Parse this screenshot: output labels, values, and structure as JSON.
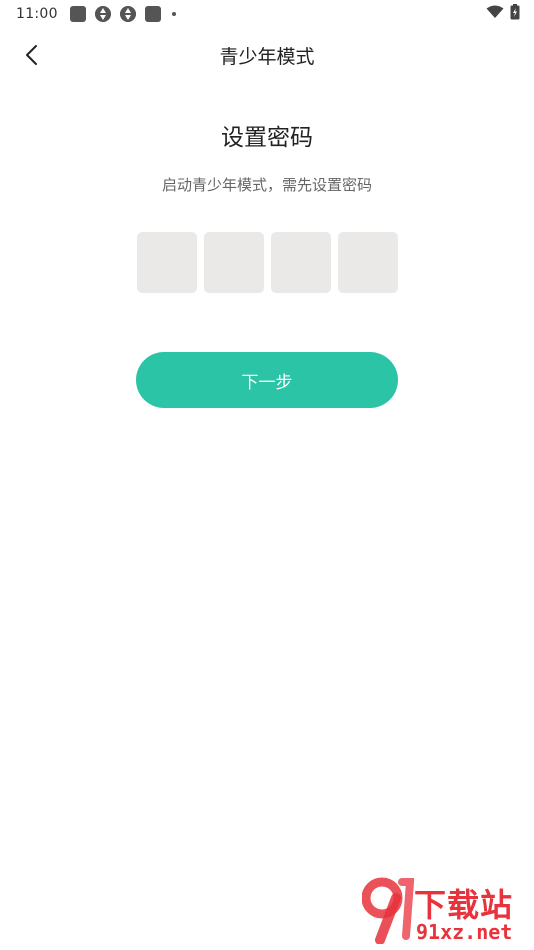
{
  "status_bar": {
    "time": "11:00",
    "left_icons": [
      "notification-square-icon",
      "notification-aperture-icon",
      "notification-aperture-icon",
      "notification-square-icon",
      "notification-dot-icon"
    ],
    "right_icons": [
      "wifi-icon",
      "battery-charging-icon"
    ]
  },
  "header": {
    "title": "青少年模式",
    "back_icon": "chevron-left-icon"
  },
  "main": {
    "title": "设置密码",
    "subtitle": "启动青少年模式，需先设置密码",
    "pin_length": 4,
    "next_button_label": "下一步"
  },
  "colors": {
    "accent": "#2bc4a6",
    "pin_box": "#ebe8e8",
    "title_text": "#222222",
    "subtitle_text": "#666666",
    "watermark": "#e8323c"
  },
  "watermark": {
    "top_text": "下载站",
    "bottom_text": "91xz.net"
  }
}
